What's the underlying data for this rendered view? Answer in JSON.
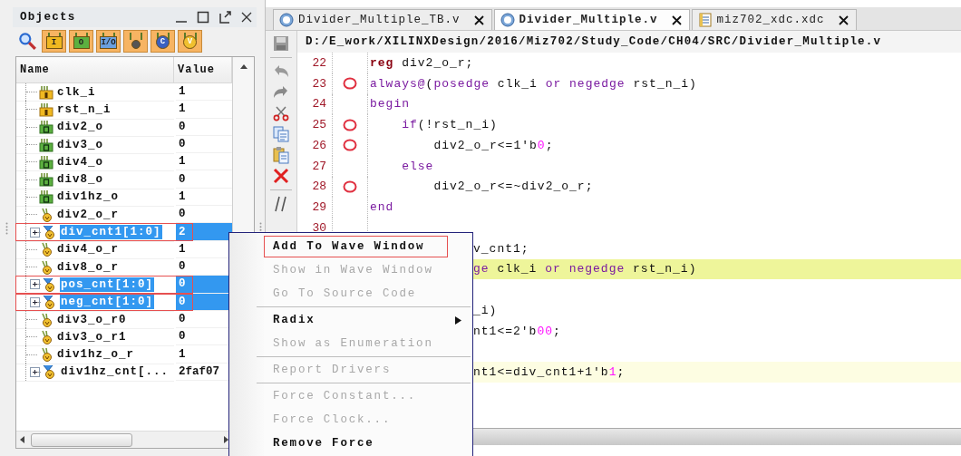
{
  "objects_panel": {
    "title": "Objects",
    "toolbar": [
      {
        "kind": "search"
      },
      {
        "kind": "in",
        "label": "I"
      },
      {
        "kind": "out",
        "label": "O"
      },
      {
        "kind": "inout",
        "label": "I/O"
      },
      {
        "kind": "internal"
      },
      {
        "kind": "constant",
        "label": "C"
      },
      {
        "kind": "variable",
        "label": "V"
      }
    ],
    "columns": [
      "Name",
      "Value"
    ],
    "rows": [
      {
        "name": "clk_i",
        "value": "1",
        "kind": "in",
        "expandable": false,
        "selected": false,
        "annotated": false
      },
      {
        "name": "rst_n_i",
        "value": "1",
        "kind": "in",
        "expandable": false,
        "selected": false,
        "annotated": false
      },
      {
        "name": "div2_o",
        "value": "0",
        "kind": "out",
        "expandable": false,
        "selected": false,
        "annotated": false
      },
      {
        "name": "div3_o",
        "value": "0",
        "kind": "out",
        "expandable": false,
        "selected": false,
        "annotated": false
      },
      {
        "name": "div4_o",
        "value": "1",
        "kind": "out",
        "expandable": false,
        "selected": false,
        "annotated": false
      },
      {
        "name": "div8_o",
        "value": "0",
        "kind": "out",
        "expandable": false,
        "selected": false,
        "annotated": false
      },
      {
        "name": "div1hz_o",
        "value": "1",
        "kind": "out",
        "expandable": false,
        "selected": false,
        "annotated": false
      },
      {
        "name": "div2_o_r",
        "value": "0",
        "kind": "reg",
        "expandable": false,
        "selected": false,
        "annotated": false
      },
      {
        "name": "div_cnt1[1:0]",
        "value": "2",
        "kind": "bus",
        "expandable": true,
        "selected": true,
        "annotated": true
      },
      {
        "name": "div4_o_r",
        "value": "1",
        "kind": "reg",
        "expandable": false,
        "selected": false,
        "annotated": false
      },
      {
        "name": "div8_o_r",
        "value": "0",
        "kind": "reg",
        "expandable": false,
        "selected": false,
        "annotated": false
      },
      {
        "name": "pos_cnt[1:0]",
        "value": "0",
        "kind": "bus",
        "expandable": true,
        "selected": true,
        "annotated": true
      },
      {
        "name": "neg_cnt[1:0]",
        "value": "0",
        "kind": "bus",
        "expandable": true,
        "selected": true,
        "annotated": true
      },
      {
        "name": "div3_o_r0",
        "value": "0",
        "kind": "reg",
        "expandable": false,
        "selected": false,
        "annotated": false
      },
      {
        "name": "div3_o_r1",
        "value": "0",
        "kind": "reg",
        "expandable": false,
        "selected": false,
        "annotated": false
      },
      {
        "name": "div1hz_o_r",
        "value": "1",
        "kind": "reg",
        "expandable": false,
        "selected": false,
        "annotated": false
      },
      {
        "name": "div1hz_cnt[...",
        "value": "2faf07",
        "kind": "bus",
        "expandable": true,
        "selected": false,
        "annotated": false
      }
    ]
  },
  "editor": {
    "tabs": [
      {
        "label": "Divider_Multiple_TB.v",
        "kind": "verilog",
        "selected": false
      },
      {
        "label": "Divider_Multiple.v",
        "kind": "verilog",
        "selected": true
      },
      {
        "label": "miz702_xdc.xdc",
        "kind": "constraints",
        "selected": false
      }
    ],
    "side_toolbar": [
      {
        "kind": "save"
      },
      {
        "kind": "separator"
      },
      {
        "kind": "undo"
      },
      {
        "kind": "redo"
      },
      {
        "kind": "cut"
      },
      {
        "kind": "copy"
      },
      {
        "kind": "paste"
      },
      {
        "kind": "delete"
      },
      {
        "kind": "separator"
      },
      {
        "kind": "comment"
      }
    ],
    "path": "D:/E_work/XILINXDesign/2016/Miz702/Study_Code/CH04/SRC/Divider_Multiple.v",
    "lines": [
      {
        "kind": "code",
        "number": "22",
        "breakpoint": false,
        "tokens": [
          {
            "text": "reg",
            "kind": "type"
          },
          {
            "text": " div2_o_r;",
            "kind": "plain"
          }
        ]
      },
      {
        "kind": "code",
        "number": "23",
        "breakpoint": true,
        "tokens": [
          {
            "text": "always@",
            "kind": "keyword"
          },
          {
            "text": "(",
            "kind": "plain"
          },
          {
            "text": "posedge",
            "kind": "keyword"
          },
          {
            "text": " clk_i ",
            "kind": "plain"
          },
          {
            "text": "or",
            "kind": "keyword"
          },
          {
            "text": " negedge",
            "kind": "keyword"
          },
          {
            "text": " rst_n_i)",
            "kind": "plain"
          }
        ]
      },
      {
        "kind": "code",
        "number": "24",
        "breakpoint": false,
        "tokens": [
          {
            "text": "begin",
            "kind": "keyword"
          }
        ]
      },
      {
        "kind": "code",
        "number": "25",
        "breakpoint": true,
        "tokens": [
          {
            "text": "    if",
            "kind": "keyword"
          },
          {
            "text": "(!rst_n_i)",
            "kind": "plain"
          }
        ]
      },
      {
        "kind": "code",
        "number": "26",
        "breakpoint": true,
        "tokens": [
          {
            "text": "        div2_o_r<=1'b",
            "kind": "plain"
          },
          {
            "text": "0",
            "kind": "number"
          },
          {
            "text": ";",
            "kind": "plain"
          }
        ]
      },
      {
        "kind": "code",
        "number": "27",
        "breakpoint": false,
        "tokens": [
          {
            "text": "    else",
            "kind": "keyword"
          }
        ]
      },
      {
        "kind": "code",
        "number": "28",
        "breakpoint": true,
        "tokens": [
          {
            "text": "        div2_o_r<=~div2_o_r;",
            "kind": "plain"
          }
        ]
      },
      {
        "kind": "code",
        "number": "29",
        "breakpoint": false,
        "tokens": [
          {
            "text": "end",
            "kind": "keyword"
          }
        ]
      },
      {
        "kind": "blank",
        "number": "30"
      },
      {
        "kind": "code",
        "partial": true,
        "tokens": [
          {
            "text": "v_cnt1;",
            "kind": "plain"
          }
        ]
      },
      {
        "kind": "code",
        "color": "#eef59a",
        "partial": true,
        "tokens": [
          {
            "text": "ge",
            "kind": "keyword"
          },
          {
            "text": " clk_i ",
            "kind": "plain"
          },
          {
            "text": "or",
            "kind": "keyword"
          },
          {
            "text": " negedge",
            "kind": "keyword"
          },
          {
            "text": " rst_n_i)",
            "kind": "plain"
          }
        ]
      },
      {
        "kind": "blank"
      },
      {
        "kind": "code",
        "partial": true,
        "tokens": [
          {
            "text": "_i)",
            "kind": "plain"
          }
        ]
      },
      {
        "kind": "code",
        "partial": true,
        "tokens": [
          {
            "text": "nt1<=2'b",
            "kind": "plain"
          },
          {
            "text": "00",
            "kind": "number"
          },
          {
            "text": ";",
            "kind": "plain"
          }
        ]
      },
      {
        "kind": "blank"
      },
      {
        "kind": "code",
        "color": "#fdfde2",
        "partial": true,
        "tokens": [
          {
            "text": "nt1<=div_cnt1+1'b",
            "kind": "plain"
          },
          {
            "text": "1",
            "kind": "number"
          },
          {
            "text": ";",
            "kind": "plain"
          }
        ]
      },
      {
        "kind": "blank"
      },
      {
        "kind": "blank"
      }
    ]
  },
  "context_menu": {
    "items": [
      {
        "kind": "item",
        "label": "Add To Wave Window",
        "disabled": false,
        "annotated": true
      },
      {
        "kind": "item",
        "label": "Show in Wave Window",
        "disabled": true,
        "annotated": false
      },
      {
        "kind": "item",
        "label": "Go To Source Code",
        "disabled": true,
        "annotated": false
      },
      {
        "kind": "separator"
      },
      {
        "kind": "submenu",
        "label": "Radix",
        "disabled": false,
        "annotated": false
      },
      {
        "kind": "item",
        "label": "Show as Enumeration",
        "disabled": true,
        "annotated": false
      },
      {
        "kind": "separator"
      },
      {
        "kind": "item",
        "label": "Report Drivers",
        "disabled": true,
        "annotated": false
      },
      {
        "kind": "separator"
      },
      {
        "kind": "item",
        "label": "Force Constant...",
        "disabled": true,
        "annotated": false
      },
      {
        "kind": "item",
        "label": "Force Clock...",
        "disabled": true,
        "annotated": false
      },
      {
        "kind": "item",
        "label": "Remove Force",
        "disabled": false,
        "annotated": false
      }
    ]
  }
}
